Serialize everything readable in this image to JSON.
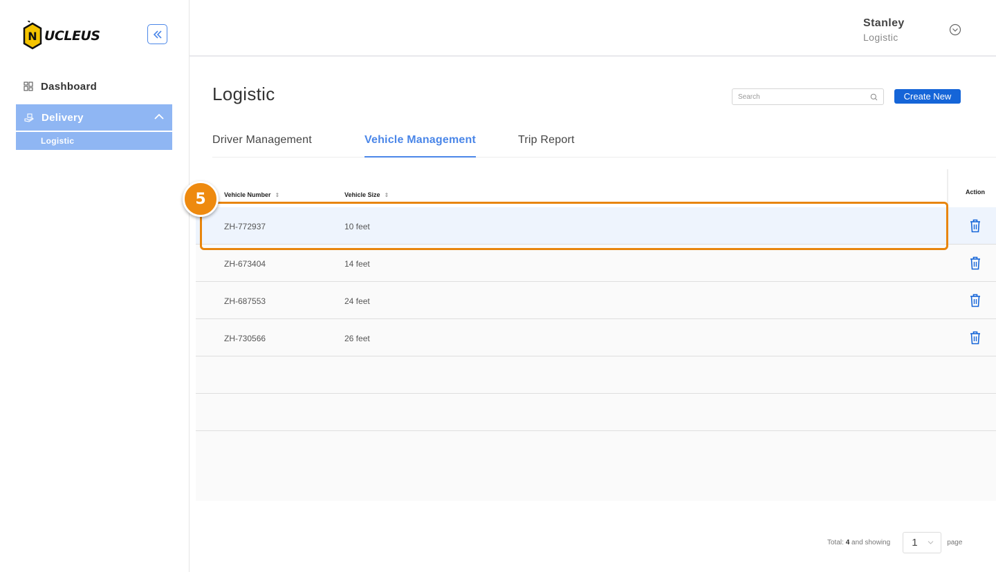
{
  "app": {
    "brand": "UCLEUS",
    "brand_letter": "N"
  },
  "sidebar": {
    "items": [
      {
        "label": "Dashboard",
        "icon": "dashboard-icon"
      },
      {
        "label": "Delivery",
        "icon": "delivery-icon",
        "expanded": true,
        "children": [
          {
            "label": "Logistic",
            "active": true
          }
        ]
      }
    ]
  },
  "header": {
    "user_name": "Stanley",
    "user_role": "Logistic"
  },
  "page": {
    "title": "Logistic",
    "search_placeholder": "Search",
    "create_label": "Create New"
  },
  "tabs": [
    {
      "label": "Driver Management",
      "active": false
    },
    {
      "label": "Vehicle Management",
      "active": true
    },
    {
      "label": "Trip Report",
      "active": false
    }
  ],
  "table": {
    "columns": [
      "Vehicle Number",
      "Vehicle Size"
    ],
    "action_label": "Action",
    "rows": [
      {
        "number": "ZH-772937",
        "size": "10 feet"
      },
      {
        "number": "ZH-673404",
        "size": "14 feet"
      },
      {
        "number": "ZH-687553",
        "size": "24 feet"
      },
      {
        "number": "ZH-730566",
        "size": "26 feet"
      }
    ]
  },
  "annotation": {
    "step": "5",
    "color": "#ee8a0f"
  },
  "pagination": {
    "prefix": "Total:",
    "total": "4",
    "suffix": "and showing",
    "page_value": "1",
    "page_label": "page"
  },
  "colors": {
    "accent": "#4a86e8",
    "primary_button": "#1565d8",
    "sidebar_active": "#8fb6f3",
    "highlight": "#e8850c"
  }
}
